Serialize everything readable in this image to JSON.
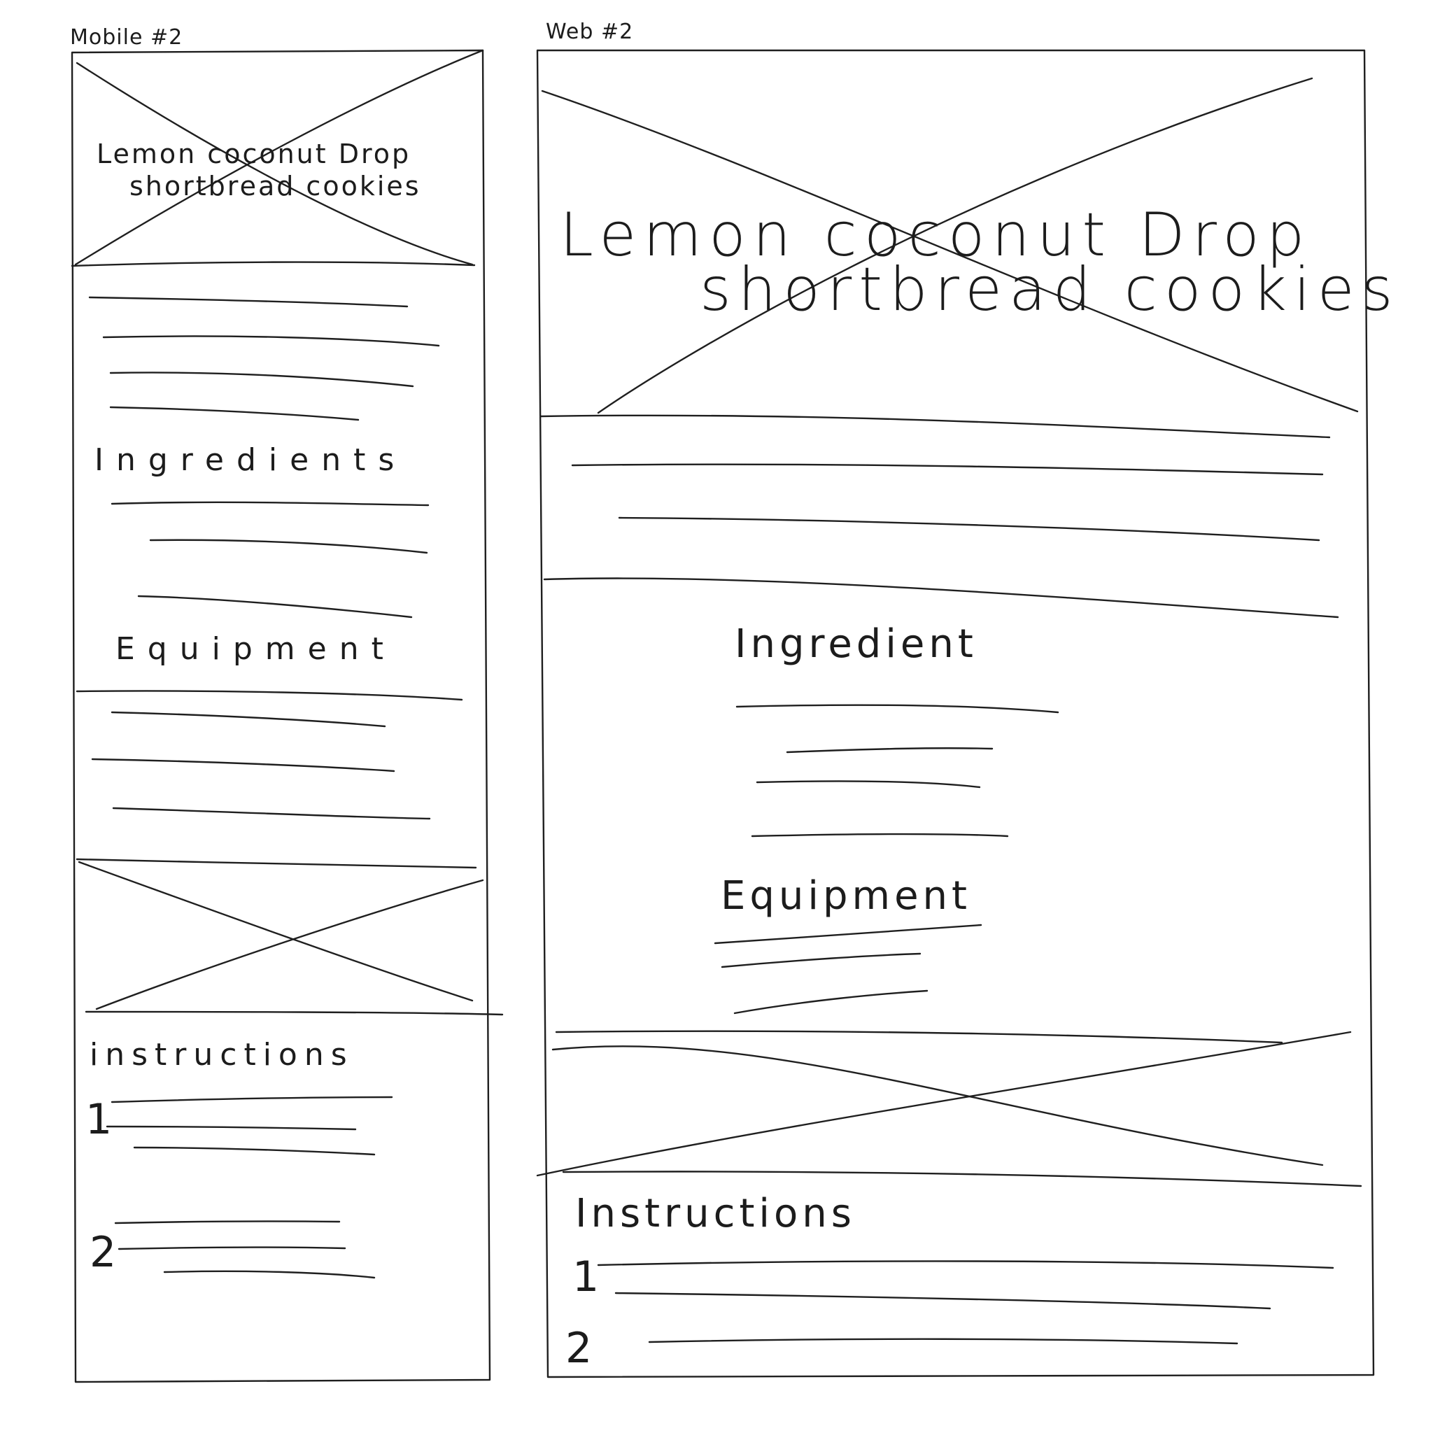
{
  "mobile": {
    "caption": "Mobile #2",
    "title_line1": "Lemon coconut Drop",
    "title_line2": "shortbread cookies",
    "ingredients_heading": "Ingredients",
    "equipment_heading": "Equipment",
    "instructions_heading": "instructions",
    "step1": "1",
    "step2": "2"
  },
  "web": {
    "caption": "Web #2",
    "title_line1": "Lemon coconut Drop",
    "title_line2": "shortbread cookies",
    "ingredients_heading": "Ingredient",
    "equipment_heading": "Equipment",
    "instructions_heading": "Instructions",
    "step1": "1",
    "step2": "2"
  }
}
